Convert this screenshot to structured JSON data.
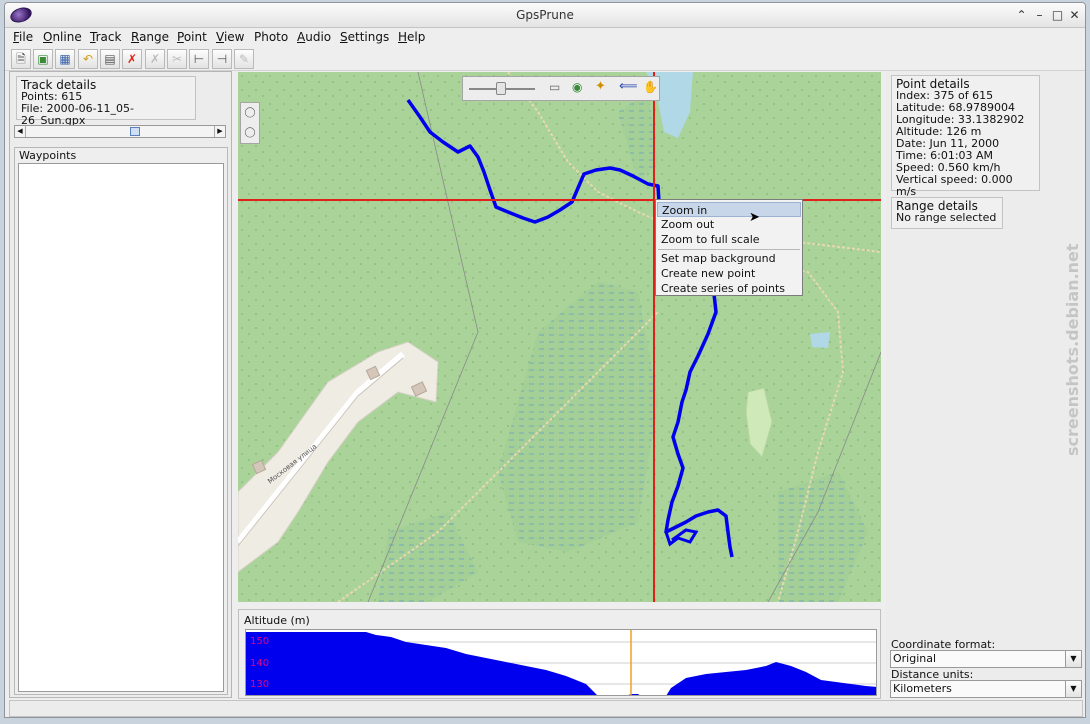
{
  "window": {
    "title": "GpsPrune"
  },
  "menubar": {
    "items": [
      {
        "label": "File",
        "underline": "F",
        "rest": "ile"
      },
      {
        "label": "Online",
        "underline": "O",
        "rest": "nline"
      },
      {
        "label": "Track",
        "underline": "T",
        "rest": "rack"
      },
      {
        "label": "Range",
        "underline": "R",
        "rest": "ange"
      },
      {
        "label": "Point",
        "underline": "P",
        "rest": "oint"
      },
      {
        "label": "View",
        "underline": "V",
        "rest": "iew"
      },
      {
        "label": "Photo",
        "underline": "",
        "rest": "Photo"
      },
      {
        "label": "Audio",
        "underline": "A",
        "rest": "udio"
      },
      {
        "label": "Settings",
        "underline": "S",
        "rest": "ettings"
      },
      {
        "label": "Help",
        "underline": "H",
        "rest": "elp"
      }
    ]
  },
  "toolbar": {
    "buttons": [
      "new-file-icon",
      "open-photo-icon",
      "save-icon",
      "undo-icon",
      "table-icon",
      "delete-icon",
      "delete-range-icon",
      "split-icon",
      "set-range-start-icon",
      "set-range-end-icon",
      "connect-photo-icon"
    ]
  },
  "track_details": {
    "title": "Track details",
    "points": "Points: 615",
    "file": "File: 2000-06-11_05-26_Sun.gpx"
  },
  "track_slider": {
    "position": 0.58
  },
  "waypoints": {
    "title": "Waypoints"
  },
  "map": {
    "road_label": "Московая улица",
    "accent_color": "#e1201b",
    "track_color": "#0000ee"
  },
  "context_menu": {
    "items": [
      "Zoom in",
      "Zoom out",
      "Zoom to full scale",
      "Set map background",
      "Create new point",
      "Create series of points"
    ],
    "selected": "Zoom in"
  },
  "profile": {
    "title": "Altitude (m)",
    "ticks": [
      "150",
      "140",
      "130"
    ],
    "tick_color": "#e0008c"
  },
  "point_details": {
    "title": "Point details",
    "lines": [
      "Index: 375 of 615",
      "Latitude: 68.9789004",
      "Longitude: 33.1382902",
      "Altitude: 126 m",
      "Date: Jun 11, 2000",
      "Time: 6:01:03 AM",
      "Speed: 0.560 km/h",
      "Vertical speed: 0.000 m/s"
    ]
  },
  "range_details": {
    "title": "Range details",
    "text": "No range selected"
  },
  "settings": {
    "coord_label": "Coordinate format:",
    "coord_value": "Original",
    "dist_label": "Distance units:",
    "dist_value": "Kilometers"
  },
  "watermark": {
    "text": "screenshots.debian.net"
  }
}
